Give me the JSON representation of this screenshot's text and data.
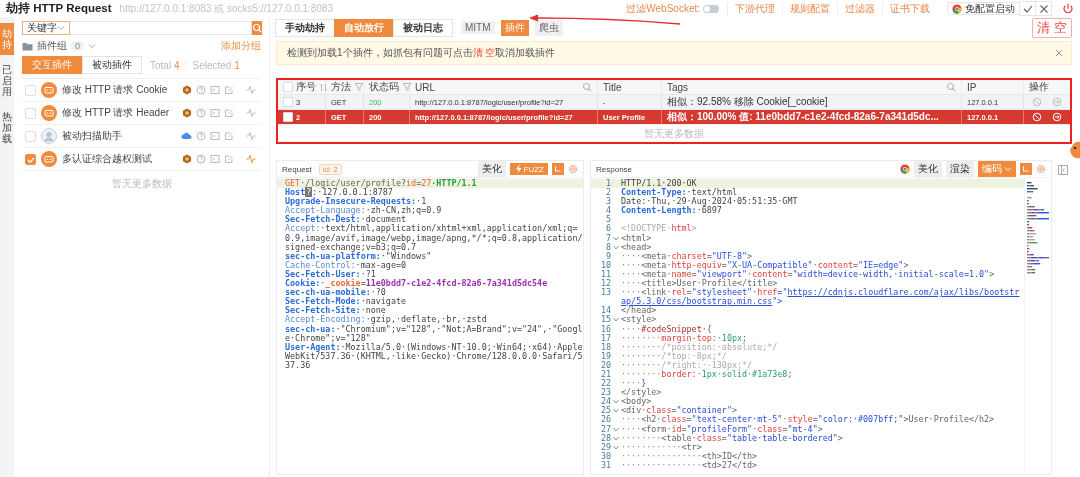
{
  "window": {
    "title": "劫持 HTTP Request",
    "proxy_address": "http://127.0.0.1:8083 或 socks5://127.0.0.1:8083"
  },
  "toolbar": {
    "websocket_filter": {
      "label": "过滤WebSocket:",
      "on": false
    },
    "links": [
      "下游代理",
      "规则配置",
      "过滤器",
      "证书下载"
    ],
    "launch_button": "免配置启动"
  },
  "side_tabs": [
    {
      "label": "劫持",
      "selected": true
    },
    {
      "label": "已启用",
      "selected": false
    },
    {
      "label": "热加载",
      "selected": false
    }
  ],
  "plugin_panel": {
    "search_field": "关键字",
    "group": {
      "label": "插件组",
      "count": "0"
    },
    "add_group": "添加分组",
    "tabs": [
      {
        "label": "交互插件",
        "selected": true
      },
      {
        "label": "被动插件",
        "selected": false
      }
    ],
    "total": {
      "label": "Total",
      "value": "4"
    },
    "selected_count": {
      "label": "Selected",
      "value": "1"
    },
    "plugins": [
      {
        "name": "修改 HTTP 请求 Cookie",
        "checked": false,
        "kind": "bot"
      },
      {
        "name": "修改 HTTP 请求 Header",
        "checked": false,
        "kind": "bot"
      },
      {
        "name": "被动扫描助手",
        "checked": false,
        "kind": "person"
      },
      {
        "name": "多认证综合越权测试",
        "checked": true,
        "kind": "bot"
      }
    ],
    "empty_text": "暂无更多数据"
  },
  "traffic": {
    "modes": [
      {
        "label": "手动劫持",
        "selected": false
      },
      {
        "label": "自动放行",
        "selected": true
      },
      {
        "label": "被动日志",
        "selected": false
      }
    ],
    "extras": [
      {
        "label": "MITM",
        "selected": false
      },
      {
        "label": "插件",
        "selected": true
      },
      {
        "label": "爬虫",
        "selected": false
      }
    ],
    "clear_button": "清 空",
    "alert": {
      "before": "检测到加载1个插件，如抓包有问题可点击",
      "link": "清 空",
      "after": "取消加载插件"
    },
    "table": {
      "select_all": {
        "checked": false
      },
      "columns": [
        {
          "label": "序号",
          "kind": "sort"
        },
        {
          "label": "方法",
          "kind": "filter"
        },
        {
          "label": "状态码",
          "kind": "filter"
        },
        {
          "label": "URL",
          "kind": "search"
        },
        {
          "label": "Title",
          "kind": "plain"
        },
        {
          "label": "Tags",
          "kind": "search"
        },
        {
          "label": "IP",
          "kind": "plain"
        },
        {
          "label": "操作",
          "kind": "plain"
        }
      ],
      "rows": [
        {
          "cells": [
            "3",
            "GET",
            "200",
            "http://127.0.0.1:8787/logic/user/profile?id=27",
            "-",
            "相似：92.58% 移除 Cookie[_cookie]",
            "127.0.0.1"
          ],
          "checked": false,
          "selected": false
        },
        {
          "cells": [
            "2",
            "GET",
            "200",
            "http://127.0.0.1:8787/logic/user/profile?id=27",
            "User Profile",
            "相似：100.00% 值: 11e0bdd7-c1e2-4fcd-82a6-7a341d5dc...",
            "127.0.0.1"
          ],
          "checked": false,
          "selected": true
        }
      ],
      "empty_text": "暂无更多数据"
    }
  },
  "request": {
    "title": "Request",
    "id_badge": "id: 2",
    "buttons": [
      "美化"
    ],
    "fuzz_button": "FUZZ",
    "lines": [
      {
        "highlighted": true,
        "tokens": [
          {
            "text": "GET",
            "kind": "method"
          },
          {
            "text": "·/logic/user/profile?",
            "kind": "path"
          },
          {
            "text": "id",
            "kind": "param"
          },
          {
            "text": "=",
            "kind": "path"
          },
          {
            "text": "27",
            "kind": "param"
          },
          {
            "text": "·HTTP/1.1",
            "kind": "proto"
          }
        ]
      },
      {
        "highlighted": false,
        "tokens": [
          {
            "text": "Host",
            "kind": "key"
          },
          {
            "text": "?",
            "kind": "mark"
          },
          {
            "text": ":·127.0.0.1:8787",
            "kind": "plain"
          }
        ]
      },
      {
        "highlighted": false,
        "tokens": [
          {
            "text": "Upgrade-Insecure-Requests:",
            "kind": "key"
          },
          {
            "text": "·1",
            "kind": "plain"
          }
        ]
      },
      {
        "highlighted": false,
        "tokens": [
          {
            "text": "Accept-Language:",
            "kind": "lkey"
          },
          {
            "text": "·zh-CN,zh;q=0.9",
            "kind": "plain"
          }
        ]
      },
      {
        "highlighted": false,
        "tokens": [
          {
            "text": "Sec-Fetch-Dest:",
            "kind": "key"
          },
          {
            "text": "·document",
            "kind": "plain"
          }
        ]
      },
      {
        "highlighted": false,
        "tokens": [
          {
            "text": "Accept:",
            "kind": "lkey"
          },
          {
            "text": "·text/html,application/xhtml+xml,application/xml;q=0.9,image/avif,image/webp,image/apng,*/*;q=0.8,application/signed-exchange;v=b3;q=0.7",
            "kind": "plain"
          }
        ]
      },
      {
        "highlighted": false,
        "tokens": [
          {
            "text": "sec-ch-ua-platform:",
            "kind": "key"
          },
          {
            "text": "·\"Windows\"",
            "kind": "plain"
          }
        ]
      },
      {
        "highlighted": false,
        "tokens": [
          {
            "text": "Cache-Control:",
            "kind": "lkey"
          },
          {
            "text": "·max-age=0",
            "kind": "plain"
          }
        ]
      },
      {
        "highlighted": false,
        "tokens": [
          {
            "text": "Sec-Fetch-User:",
            "kind": "key"
          },
          {
            "text": "·?1",
            "kind": "plain"
          }
        ]
      },
      {
        "highlighted": false,
        "tokens": [
          {
            "text": "Cookie:",
            "kind": "key"
          },
          {
            "text": "·",
            "kind": "plain"
          },
          {
            "text": "_cookie",
            "kind": "cname"
          },
          {
            "text": "=",
            "kind": "plain"
          },
          {
            "text": "11e0bdd7-c1e2-4fcd-82a6-7a341d5dc54e",
            "kind": "cval"
          }
        ]
      },
      {
        "highlighted": false,
        "tokens": [
          {
            "text": "sec-ch-ua-mobile:",
            "kind": "key"
          },
          {
            "text": "·?0",
            "kind": "plain"
          }
        ]
      },
      {
        "highlighted": false,
        "tokens": [
          {
            "text": "Sec-Fetch-Mode:",
            "kind": "key"
          },
          {
            "text": "·navigate",
            "kind": "plain"
          }
        ]
      },
      {
        "highlighted": false,
        "tokens": [
          {
            "text": "Sec-Fetch-Site:",
            "kind": "key"
          },
          {
            "text": "·none",
            "kind": "plain"
          }
        ]
      },
      {
        "highlighted": false,
        "tokens": [
          {
            "text": "Accept-Encoding:",
            "kind": "lkey"
          },
          {
            "text": "·gzip,·deflate,·br,·zstd",
            "kind": "plain"
          }
        ]
      },
      {
        "highlighted": false,
        "tokens": [
          {
            "text": "sec-ch-ua:",
            "kind": "key"
          },
          {
            "text": "·\"Chromium\";v=\"128\",·\"Not;A=Brand\";v=\"24\",·\"Google·Chrome\";v=\"128\"",
            "kind": "plain"
          }
        ]
      },
      {
        "highlighted": false,
        "tokens": [
          {
            "text": "User-Agent:",
            "kind": "key"
          },
          {
            "text": "·Mozilla/5.0·(Windows·NT·10.0;·Win64;·x64)·AppleWebKit/537.36·(KHTML,·like·Gecko)·Chrome/128.0.0.0·Safari/537.36",
            "kind": "plain"
          }
        ]
      }
    ]
  },
  "response": {
    "title": "Response",
    "buttons": [
      "美化",
      "渲染"
    ],
    "encoding_button": "编码",
    "lines": [
      {
        "no": "1",
        "fold": false,
        "highlighted": true,
        "tokens": [
          {
            "text": "HTTP/1.1·200·OK",
            "kind": "plain"
          }
        ]
      },
      {
        "no": "2",
        "fold": false,
        "highlighted": false,
        "tokens": [
          {
            "text": "Content-Type:",
            "kind": "key"
          },
          {
            "text": "·text/html",
            "kind": "plain"
          }
        ]
      },
      {
        "no": "3",
        "fold": false,
        "highlighted": false,
        "tokens": [
          {
            "text": "Date:·Thu,·29·Aug·2024·05:51:35·GMT",
            "kind": "plain"
          }
        ]
      },
      {
        "no": "4",
        "fold": false,
        "highlighted": false,
        "tokens": [
          {
            "text": "Content-Length:",
            "kind": "key"
          },
          {
            "text": "·6897",
            "kind": "plain"
          }
        ]
      },
      {
        "no": "5",
        "fold": false,
        "highlighted": false
      },
      {
        "no": "6",
        "fold": false,
        "highlighted": false,
        "tokens": [
          {
            "text": "<!DOCTYPE·",
            "kind": "comment"
          },
          {
            "text": "html",
            "kind": "attr"
          },
          {
            "text": ">",
            "kind": "comment"
          }
        ]
      },
      {
        "no": "7",
        "fold": true,
        "highlighted": false,
        "tokens": [
          {
            "text": "<html>",
            "kind": "tag"
          }
        ]
      },
      {
        "no": "8",
        "fold": true,
        "highlighted": false,
        "tokens": [
          {
            "text": "<head>",
            "kind": "tag"
          }
        ]
      },
      {
        "no": "9",
        "fold": false,
        "highlighted": false,
        "tokens": [
          {
            "text": "····",
            "kind": "ws"
          },
          {
            "text": "<meta·",
            "kind": "tag"
          },
          {
            "text": "charset",
            "kind": "attr"
          },
          {
            "text": "=",
            "kind": "tag"
          },
          {
            "text": "\"UTF-8\"",
            "kind": "str"
          },
          {
            "text": ">",
            "kind": "tag"
          }
        ]
      },
      {
        "no": "10",
        "fold": false,
        "highlighted": false,
        "tokens": [
          {
            "text": "····",
            "kind": "ws"
          },
          {
            "text": "<meta·",
            "kind": "tag"
          },
          {
            "text": "http-equiv",
            "kind": "attr"
          },
          {
            "text": "=",
            "kind": "tag"
          },
          {
            "text": "\"X-UA-Compatible\"",
            "kind": "str"
          },
          {
            "text": "·",
            "kind": "tag"
          },
          {
            "text": "content",
            "kind": "attr"
          },
          {
            "text": "=",
            "kind": "tag"
          },
          {
            "text": "\"IE=edge\"",
            "kind": "str"
          },
          {
            "text": ">",
            "kind": "tag"
          }
        ]
      },
      {
        "no": "11",
        "fold": false,
        "highlighted": false,
        "tokens": [
          {
            "text": "····",
            "kind": "ws"
          },
          {
            "text": "<meta·",
            "kind": "tag"
          },
          {
            "text": "name",
            "kind": "attr"
          },
          {
            "text": "=",
            "kind": "tag"
          },
          {
            "text": "\"viewport\"",
            "kind": "str"
          },
          {
            "text": "·",
            "kind": "tag"
          },
          {
            "text": "content",
            "kind": "attr"
          },
          {
            "text": "=",
            "kind": "tag"
          },
          {
            "text": "\"width=device-width,·initial-scale=1.0\"",
            "kind": "str"
          },
          {
            "text": ">",
            "kind": "tag"
          }
        ]
      },
      {
        "no": "12",
        "fold": false,
        "highlighted": false,
        "tokens": [
          {
            "text": "····",
            "kind": "ws"
          },
          {
            "text": "<title>User·Profile</title>",
            "kind": "tag"
          }
        ]
      },
      {
        "no": "13",
        "fold": false,
        "highlighted": false,
        "tokens": [
          {
            "text": "····",
            "kind": "ws"
          },
          {
            "text": "<link·",
            "kind": "tag"
          },
          {
            "text": "rel",
            "kind": "attr"
          },
          {
            "text": "=",
            "kind": "tag"
          },
          {
            "text": "\"stylesheet\"",
            "kind": "str"
          },
          {
            "text": "·",
            "kind": "tag"
          },
          {
            "text": "href",
            "kind": "attr"
          },
          {
            "text": "=\"",
            "kind": "str"
          },
          {
            "text": "https://cdnjs.cloudflare.com/ajax/libs/bootstrap/5.3.0/css/bootstrap.min.css",
            "kind": "link"
          },
          {
            "text": "\">",
            "kind": "str"
          }
        ]
      },
      {
        "no": "14",
        "fold": false,
        "highlighted": false,
        "tokens": [
          {
            "text": "</head>",
            "kind": "tag"
          }
        ]
      },
      {
        "no": "15",
        "fold": true,
        "highlighted": false,
        "tokens": [
          {
            "text": "<style>",
            "kind": "tag"
          }
        ]
      },
      {
        "no": "16",
        "fold": false,
        "highlighted": false,
        "tokens": [
          {
            "text": "····",
            "kind": "ws"
          },
          {
            "text": "#codeSnippet",
            "kind": "sel"
          },
          {
            "text": "·{",
            "kind": "tag"
          }
        ]
      },
      {
        "no": "17",
        "fold": false,
        "highlighted": false,
        "tokens": [
          {
            "text": "········",
            "kind": "ws"
          },
          {
            "text": "margin-top:",
            "kind": "attr"
          },
          {
            "text": "·10px",
            "kind": "num"
          },
          {
            "text": ";",
            "kind": "tag"
          }
        ]
      },
      {
        "no": "18",
        "fold": false,
        "highlighted": false,
        "tokens": [
          {
            "text": "········",
            "kind": "ws"
          },
          {
            "text": "/*position:·absolute;*/",
            "kind": "comment"
          }
        ]
      },
      {
        "no": "19",
        "fold": false,
        "highlighted": false,
        "tokens": [
          {
            "text": "········",
            "kind": "ws"
          },
          {
            "text": "/*top:·8px;*/",
            "kind": "comment"
          }
        ]
      },
      {
        "no": "20",
        "fold": false,
        "highlighted": false,
        "tokens": [
          {
            "text": "········",
            "kind": "ws"
          },
          {
            "text": "/*right:·-130px;*/",
            "kind": "comment"
          }
        ]
      },
      {
        "no": "21",
        "fold": false,
        "highlighted": false,
        "tokens": [
          {
            "text": "········",
            "kind": "ws"
          },
          {
            "text": "border:",
            "kind": "attr"
          },
          {
            "text": "·1px·solid·#1a73e8",
            "kind": "num"
          },
          {
            "text": ";",
            "kind": "tag"
          }
        ]
      },
      {
        "no": "22",
        "fold": false,
        "highlighted": false,
        "tokens": [
          {
            "text": "····",
            "kind": "ws"
          },
          {
            "text": "}",
            "kind": "str"
          }
        ]
      },
      {
        "no": "23",
        "fold": false,
        "highlighted": false,
        "tokens": [
          {
            "text": "</style>",
            "kind": "tag"
          }
        ]
      },
      {
        "no": "24",
        "fold": true,
        "highlighted": false,
        "tokens": [
          {
            "text": "<body>",
            "kind": "tag"
          }
        ]
      },
      {
        "no": "25",
        "fold": true,
        "highlighted": false,
        "tokens": [
          {
            "text": "<div·",
            "kind": "tag"
          },
          {
            "text": "class",
            "kind": "attr"
          },
          {
            "text": "=",
            "kind": "tag"
          },
          {
            "text": "\"container\"",
            "kind": "str"
          },
          {
            "text": ">",
            "kind": "tag"
          }
        ]
      },
      {
        "no": "26",
        "fold": false,
        "highlighted": false,
        "tokens": [
          {
            "text": "····",
            "kind": "ws"
          },
          {
            "text": "<h2·",
            "kind": "tag"
          },
          {
            "text": "class",
            "kind": "attr"
          },
          {
            "text": "=",
            "kind": "tag"
          },
          {
            "text": "\"text-center·mt-5\"",
            "kind": "str"
          },
          {
            "text": "·",
            "kind": "tag"
          },
          {
            "text": "style",
            "kind": "attr"
          },
          {
            "text": "=",
            "kind": "tag"
          },
          {
            "text": "\"color:·#007bff;\"",
            "kind": "str"
          },
          {
            "text": ">User·Profile</h2>",
            "kind": "tag"
          }
        ]
      },
      {
        "no": "27",
        "fold": true,
        "highlighted": false,
        "tokens": [
          {
            "text": "····",
            "kind": "ws"
          },
          {
            "text": "<form·",
            "kind": "tag"
          },
          {
            "text": "id",
            "kind": "attr"
          },
          {
            "text": "=",
            "kind": "tag"
          },
          {
            "text": "\"profileForm\"",
            "kind": "str"
          },
          {
            "text": "·",
            "kind": "tag"
          },
          {
            "text": "class",
            "kind": "attr"
          },
          {
            "text": "=",
            "kind": "tag"
          },
          {
            "text": "\"mt-4\"",
            "kind": "str"
          },
          {
            "text": ">",
            "kind": "tag"
          }
        ]
      },
      {
        "no": "28",
        "fold": true,
        "highlighted": false,
        "tokens": [
          {
            "text": "········",
            "kind": "ws"
          },
          {
            "text": "<table·",
            "kind": "tag"
          },
          {
            "text": "class",
            "kind": "attr"
          },
          {
            "text": "=",
            "kind": "tag"
          },
          {
            "text": "\"table·table-bordered\"",
            "kind": "str"
          },
          {
            "text": ">",
            "kind": "tag"
          }
        ]
      },
      {
        "no": "29",
        "fold": true,
        "highlighted": false,
        "tokens": [
          {
            "text": "············",
            "kind": "ws"
          },
          {
            "text": "<tr>",
            "kind": "tag"
          }
        ]
      },
      {
        "no": "30",
        "fold": false,
        "highlighted": false,
        "tokens": [
          {
            "text": "················",
            "kind": "ws"
          },
          {
            "text": "<th>ID</th>",
            "kind": "tag"
          }
        ]
      },
      {
        "no": "31",
        "fold": false,
        "highlighted": false,
        "tokens": [
          {
            "text": "················",
            "kind": "ws"
          },
          {
            "text": "<td>27</td>",
            "kind": "tag"
          }
        ]
      }
    ]
  }
}
